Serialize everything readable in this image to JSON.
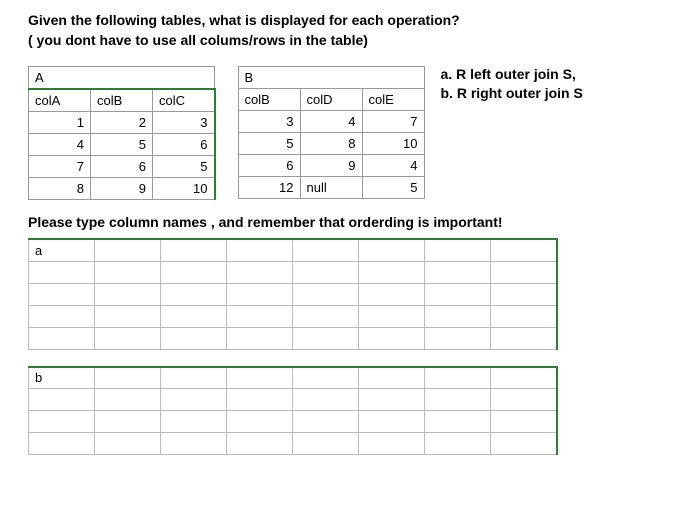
{
  "title": "Given the following tables, what is displayed for each operation?",
  "subtitle": "( you dont have to use all colums/rows in the table)",
  "tableA": {
    "name": "A",
    "headers": [
      "colA",
      "colB",
      "colC"
    ],
    "rows": [
      [
        "1",
        "2",
        "3"
      ],
      [
        "4",
        "5",
        "6"
      ],
      [
        "7",
        "6",
        "5"
      ],
      [
        "8",
        "9",
        "10"
      ]
    ]
  },
  "tableB": {
    "name": "B",
    "headers": [
      "colB",
      "colD",
      "colE"
    ],
    "rows": [
      [
        "3",
        "4",
        "7"
      ],
      [
        "5",
        "8",
        "10"
      ],
      [
        "6",
        "9",
        "4"
      ],
      [
        "12",
        "null",
        "5"
      ]
    ]
  },
  "legend": {
    "a": "a. R left outer join S,",
    "b": "b. R right outer join S"
  },
  "instruction": "Please type column names , and remember that orderding is important!",
  "answers": {
    "a_label": "a",
    "b_label": "b"
  }
}
